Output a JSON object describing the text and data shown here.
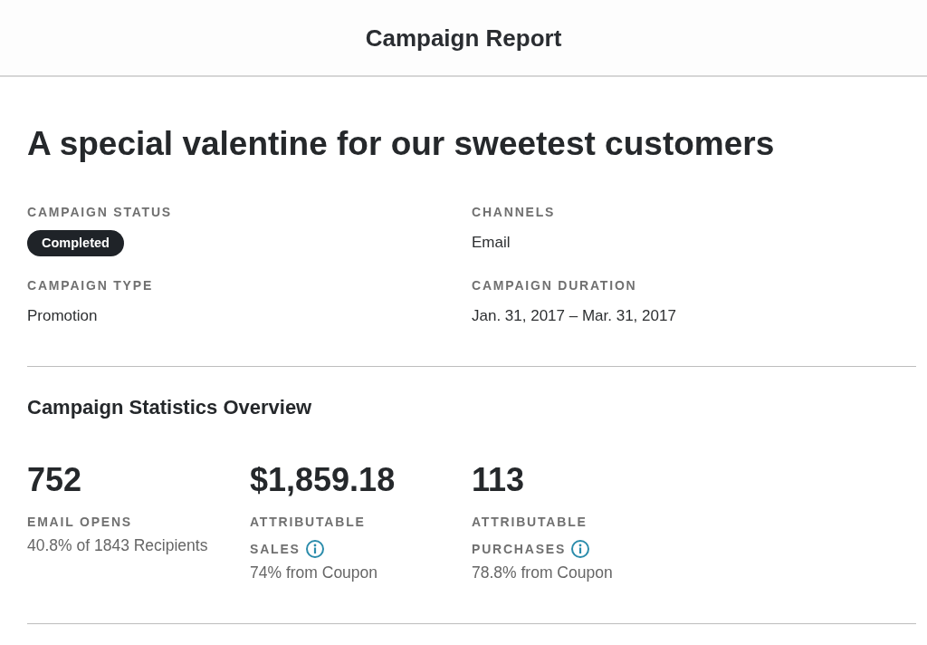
{
  "header": {
    "title": "Campaign Report"
  },
  "campaign": {
    "title": "A special valentine for our sweetest customers",
    "details": [
      {
        "label": "CAMPAIGN STATUS",
        "kind": "badge",
        "value": "Completed"
      },
      {
        "label": "CHANNELS",
        "kind": "text",
        "value": "Email"
      },
      {
        "label": "CAMPAIGN TYPE",
        "kind": "text",
        "value": "Promotion"
      },
      {
        "label": "CAMPAIGN DURATION",
        "kind": "text",
        "value": "Jan. 31, 2017 – Mar. 31, 2017"
      }
    ]
  },
  "statistics": {
    "title": "Campaign Statistics Overview",
    "stats": [
      {
        "value": "752",
        "label_lines": [
          "EMAIL OPENS"
        ],
        "info": false,
        "note": "40.8% of 1843 Recipients"
      },
      {
        "value": "$1,859.18",
        "label_lines": [
          "ATTRIBUTABLE",
          "SALES"
        ],
        "info": true,
        "note": "74% from Coupon"
      },
      {
        "value": "113",
        "label_lines": [
          "ATTRIBUTABLE",
          "PURCHASES"
        ],
        "info": true,
        "note": "78.8% from Coupon"
      }
    ]
  }
}
